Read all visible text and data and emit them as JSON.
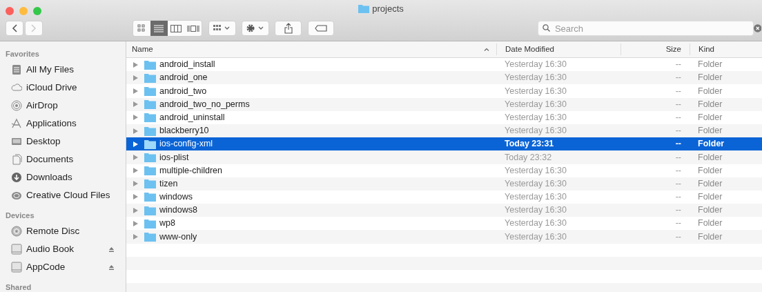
{
  "window": {
    "title": "projects"
  },
  "toolbar": {
    "forward_disabled": true,
    "view_modes": [
      {
        "selected": false
      },
      {
        "selected": true
      },
      {
        "selected": false
      },
      {
        "selected": false
      }
    ],
    "search": {
      "placeholder": "Search"
    }
  },
  "sidebar": {
    "sections": [
      {
        "title": "Favorites",
        "items": [
          {
            "label": "All My Files"
          },
          {
            "label": "iCloud Drive"
          },
          {
            "label": "AirDrop"
          },
          {
            "label": "Applications"
          },
          {
            "label": "Desktop"
          },
          {
            "label": "Documents"
          },
          {
            "label": "Downloads"
          },
          {
            "label": "Creative Cloud Files"
          }
        ]
      },
      {
        "title": "Devices",
        "items": [
          {
            "label": "Remote Disc",
            "ejectable": false
          },
          {
            "label": "Audio Book",
            "ejectable": true
          },
          {
            "label": "AppCode",
            "ejectable": true
          }
        ]
      },
      {
        "title": "Shared"
      }
    ]
  },
  "table": {
    "columns": [
      {
        "label": "Name",
        "sorted": true
      },
      {
        "label": "Date Modified",
        "sorted": false
      },
      {
        "label": "Size",
        "sorted": false
      },
      {
        "label": "Kind",
        "sorted": false
      }
    ],
    "rows": [
      {
        "name": "android_install",
        "date": "Yesterday 16:30",
        "size": "--",
        "kind": "Folder",
        "selected": false
      },
      {
        "name": "android_one",
        "date": "Yesterday 16:30",
        "size": "--",
        "kind": "Folder",
        "selected": false
      },
      {
        "name": "android_two",
        "date": "Yesterday 16:30",
        "size": "--",
        "kind": "Folder",
        "selected": false
      },
      {
        "name": "android_two_no_perms",
        "date": "Yesterday 16:30",
        "size": "--",
        "kind": "Folder",
        "selected": false
      },
      {
        "name": "android_uninstall",
        "date": "Yesterday 16:30",
        "size": "--",
        "kind": "Folder",
        "selected": false
      },
      {
        "name": "blackberry10",
        "date": "Yesterday 16:30",
        "size": "--",
        "kind": "Folder",
        "selected": false
      },
      {
        "name": "ios-config-xml",
        "date": "Today 23:31",
        "size": "--",
        "kind": "Folder",
        "selected": true
      },
      {
        "name": "ios-plist",
        "date": "Today 23:32",
        "size": "--",
        "kind": "Folder",
        "selected": false
      },
      {
        "name": "multiple-children",
        "date": "Yesterday 16:30",
        "size": "--",
        "kind": "Folder",
        "selected": false
      },
      {
        "name": "tizen",
        "date": "Yesterday 16:30",
        "size": "--",
        "kind": "Folder",
        "selected": false
      },
      {
        "name": "windows",
        "date": "Yesterday 16:30",
        "size": "--",
        "kind": "Folder",
        "selected": false
      },
      {
        "name": "windows8",
        "date": "Yesterday 16:30",
        "size": "--",
        "kind": "Folder",
        "selected": false
      },
      {
        "name": "wp8",
        "date": "Yesterday 16:30",
        "size": "--",
        "kind": "Folder",
        "selected": false
      },
      {
        "name": "www-only",
        "date": "Yesterday 16:30",
        "size": "--",
        "kind": "Folder",
        "selected": false
      }
    ]
  }
}
